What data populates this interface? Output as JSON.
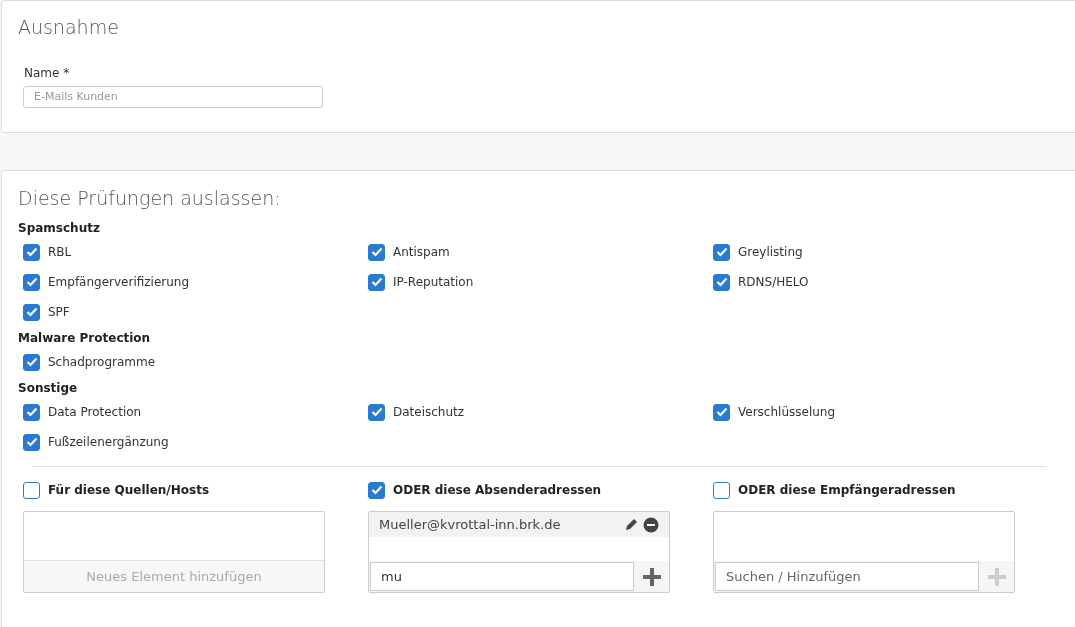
{
  "exception": {
    "title": "Ausnahme",
    "name_label": "Name *",
    "name_field": {
      "placeholder": "E-Mails Kunden"
    }
  },
  "skip_checks": {
    "title": "Diese Prüfungen auslassen:",
    "groups": [
      {
        "title": "Spamschutz",
        "items": [
          {
            "label": "RBL",
            "checked": true
          },
          {
            "label": "Antispam",
            "checked": true
          },
          {
            "label": "Greylisting",
            "checked": true
          },
          {
            "label": "Empfängerverifizierung",
            "checked": true
          },
          {
            "label": "IP-Reputation",
            "checked": true
          },
          {
            "label": "RDNS/HELO",
            "checked": true
          },
          {
            "label": "SPF",
            "checked": true
          }
        ]
      },
      {
        "title": "Malware Protection",
        "items": [
          {
            "label": "Schadprogramme",
            "checked": true
          }
        ]
      },
      {
        "title": "Sonstige",
        "items": [
          {
            "label": "Data Protection",
            "checked": true
          },
          {
            "label": "Dateischutz",
            "checked": true
          },
          {
            "label": "Verschlüsselung",
            "checked": true
          },
          {
            "label": "Fußzeilenergänzung",
            "checked": true
          }
        ]
      }
    ]
  },
  "sources": [
    {
      "kind": "list",
      "label": "Für diese Quellen/Hosts",
      "checked": false,
      "add_label": "Neues Element hinzufügen"
    },
    {
      "kind": "search",
      "label": "ODER diese Absenderadressen",
      "checked": true,
      "entries": [
        "Mueller@kvrottal-inn.brk.de"
      ],
      "input": {
        "value": "mu"
      },
      "add_enabled": true
    },
    {
      "kind": "search",
      "label": "ODER diese Empfängeradressen",
      "checked": false,
      "input": {
        "placeholder": "Suchen / Hinzufügen"
      },
      "add_enabled": false
    }
  ]
}
